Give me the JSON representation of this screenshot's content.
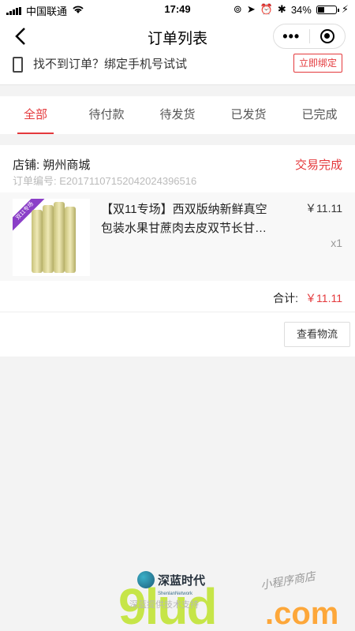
{
  "status_bar": {
    "carrier": "中国联通",
    "time": "17:49",
    "battery": "34%",
    "battery_level": 0.34
  },
  "nav": {
    "title": "订单列表",
    "more_glyph": "•••"
  },
  "bind_banner": {
    "text": "找不到订单？绑定手机号试试",
    "button": "立即绑定"
  },
  "tabs": [
    {
      "label": "全部",
      "active": true
    },
    {
      "label": "待付款",
      "active": false
    },
    {
      "label": "待发货",
      "active": false
    },
    {
      "label": "已发货",
      "active": false
    },
    {
      "label": "已完成",
      "active": false
    }
  ],
  "order": {
    "store": "店铺: 朔州商城",
    "order_no": "订单编号: E20171107152042024396516",
    "status": "交易完成",
    "product": {
      "tag": "双11专场",
      "title": "【双11专场】西双版纳新鲜真空包装水果甘蔗肉去皮双节长甘…",
      "price": "￥11.11",
      "qty": "x1"
    },
    "total_label": "合计:",
    "total_amount": "￥11.11",
    "logistics_button": "查看物流"
  },
  "footer": {
    "brand": "深蓝时代",
    "brand_sub": "ShenlanNetwork",
    "powered": "深蓝提供技术支持",
    "watermark_main": "9lud",
    "watermark_domain": ".com",
    "watermark_script": "小程序商店"
  },
  "colors": {
    "accent": "#e4393c",
    "page_bg": "#f3f3f3"
  }
}
